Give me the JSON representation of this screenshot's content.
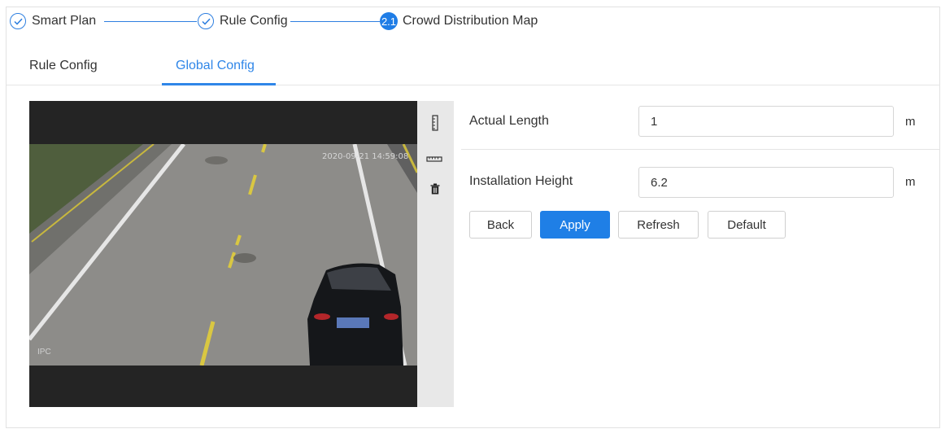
{
  "steps": [
    {
      "label": "Smart Plan",
      "state": "done"
    },
    {
      "label": "Rule Config",
      "state": "done"
    },
    {
      "label": "Crowd Distribution Map",
      "number": "2.1",
      "state": "current"
    }
  ],
  "tabs": [
    {
      "label": "Rule Config",
      "active": false
    },
    {
      "label": "Global Config",
      "active": true
    }
  ],
  "video": {
    "timestamp": "2020-09-21 14:59:08",
    "watermark": "IPC"
  },
  "toolbar": [
    "vertical-ruler-icon",
    "horizontal-ruler-icon",
    "trash-icon"
  ],
  "form": {
    "actual_length": {
      "label": "Actual Length",
      "value": "1",
      "unit": "m"
    },
    "installation_height": {
      "label": "Installation Height",
      "value": "6.2",
      "unit": "m"
    }
  },
  "buttons": {
    "back": "Back",
    "apply": "Apply",
    "refresh": "Refresh",
    "default": "Default"
  },
  "colors": {
    "accent": "#1f7fe6",
    "toolbar_bg": "#e8e8e8",
    "video_bg": "#242424"
  }
}
